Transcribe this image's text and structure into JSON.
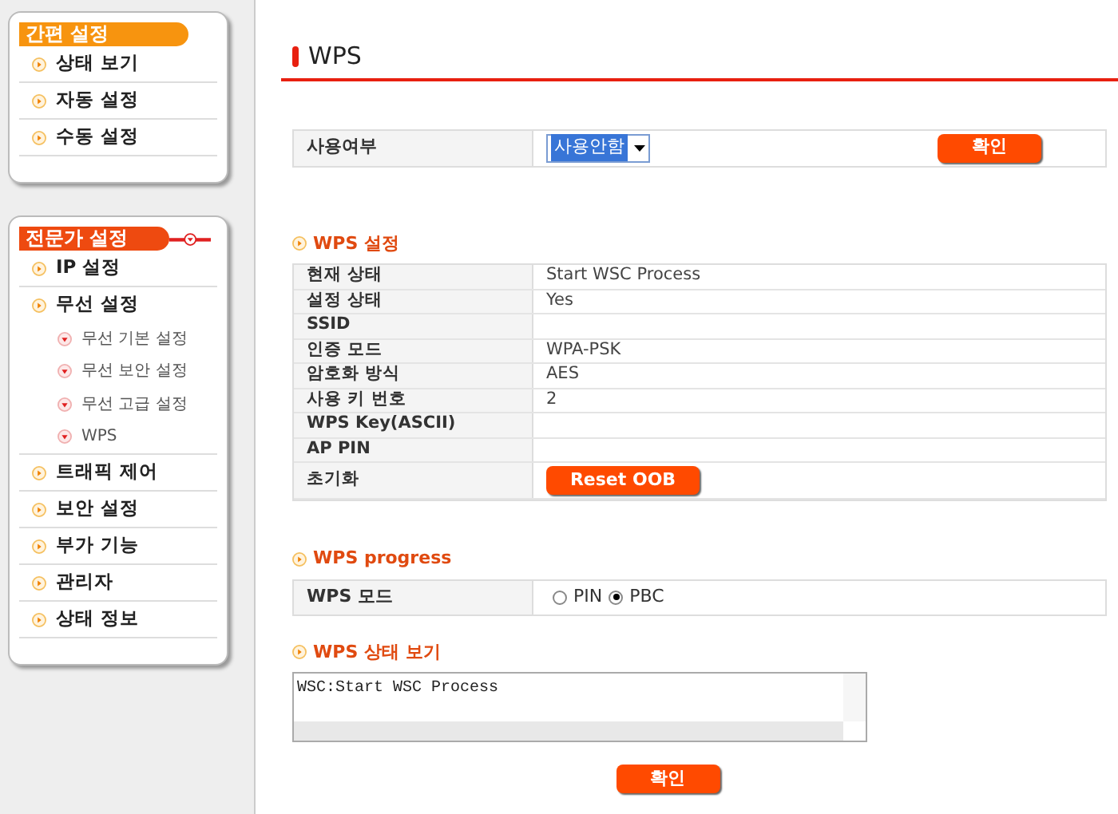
{
  "sidebar": {
    "sections": [
      {
        "title": "간편 설정",
        "kind": "basic",
        "items": [
          {
            "label": "상태 보기"
          },
          {
            "label": "자동 설정"
          },
          {
            "label": "수동 설정"
          }
        ]
      },
      {
        "title": "전문가 설정",
        "kind": "expert",
        "items": [
          {
            "label": "IP 설정"
          },
          {
            "label": "무선 설정",
            "children": [
              {
                "label": "무선 기본 설정"
              },
              {
                "label": "무선 보안 설정"
              },
              {
                "label": "무선 고급 설정"
              },
              {
                "label": "WPS"
              }
            ]
          },
          {
            "label": "트래픽 제어"
          },
          {
            "label": "보안 설정"
          },
          {
            "label": "부가 기능"
          },
          {
            "label": "관리자"
          },
          {
            "label": "상태 정보"
          }
        ]
      }
    ]
  },
  "page": {
    "title": "WPS",
    "usage": {
      "label": "사용여부",
      "select_value": "사용안함",
      "button": "확인"
    },
    "settings": {
      "heading": "WPS 설정",
      "rows": [
        {
          "label": "현재 상태",
          "value": "Start WSC Process"
        },
        {
          "label": "설정 상태",
          "value": "Yes"
        },
        {
          "label": "SSID"
        },
        {
          "label": "인증 모드",
          "value": "WPA-PSK"
        },
        {
          "label": "암호화 방식",
          "value": "AES"
        },
        {
          "label": "사용 키 번호",
          "value": "2"
        },
        {
          "label": "WPS Key(ASCII)"
        },
        {
          "label": "AP PIN"
        },
        {
          "label": "초기화",
          "button": "Reset OOB"
        }
      ]
    },
    "progress": {
      "heading": "WPS progress",
      "label": "WPS 모드",
      "options": [
        {
          "label": "PIN",
          "selected": false
        },
        {
          "label": "PBC",
          "selected": true
        }
      ]
    },
    "status": {
      "heading": "WPS 상태 보기",
      "log": "WSC:Start WSC Process"
    },
    "submit": "확인"
  }
}
